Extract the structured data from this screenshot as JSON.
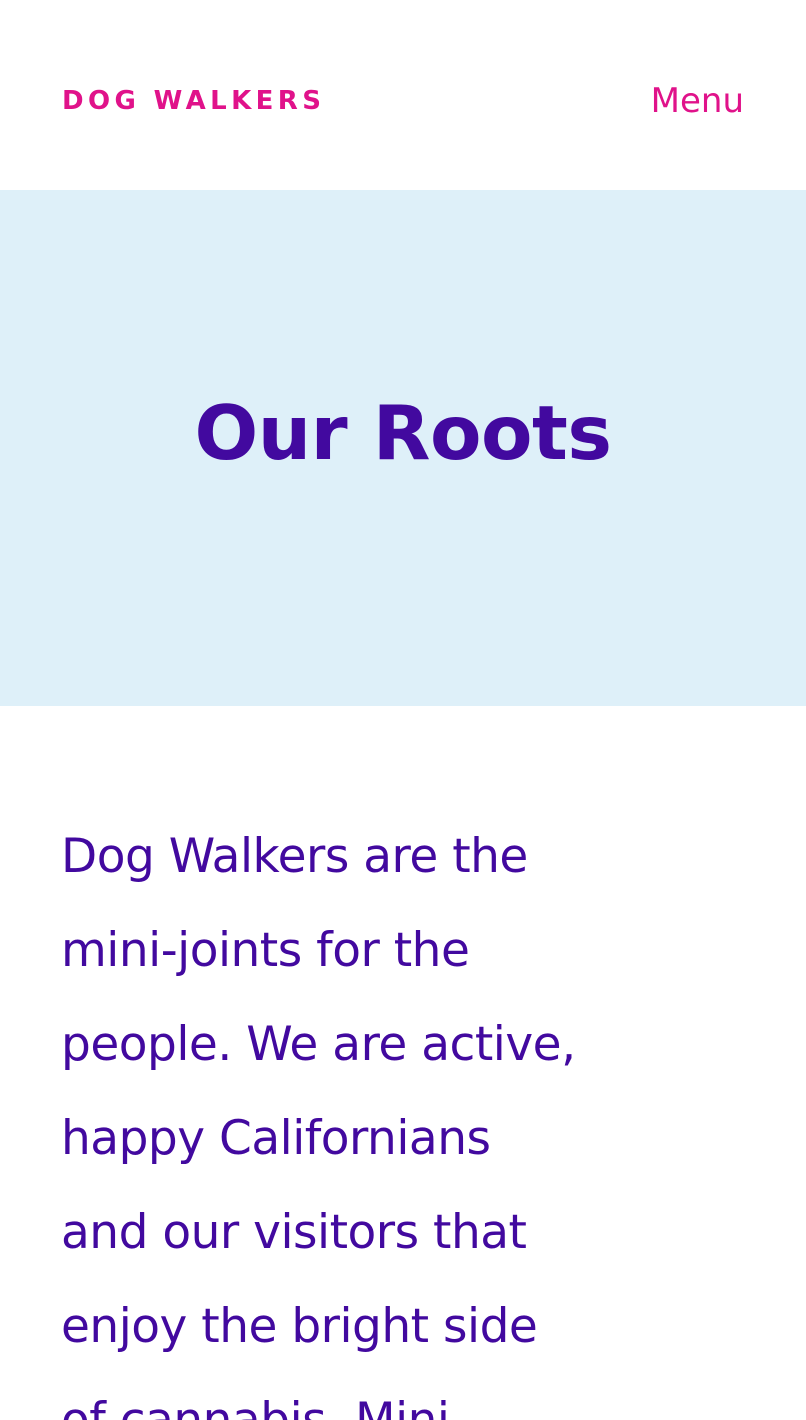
{
  "header": {
    "logo": "DOG WALKERS",
    "menu_label": "Menu"
  },
  "hero": {
    "title": "Our Roots"
  },
  "intro": {
    "lines": [
      "Dog Walkers are the",
      "mini-joints for the",
      "people. We are active,",
      "happy Californians",
      "and our visitors that",
      "enjoy the bright side",
      "of cannabis. Mini"
    ]
  },
  "colors": {
    "accent": "#e0128a",
    "text": "#42099f",
    "hero_background": "#def0f9",
    "background": "#ffffff"
  }
}
